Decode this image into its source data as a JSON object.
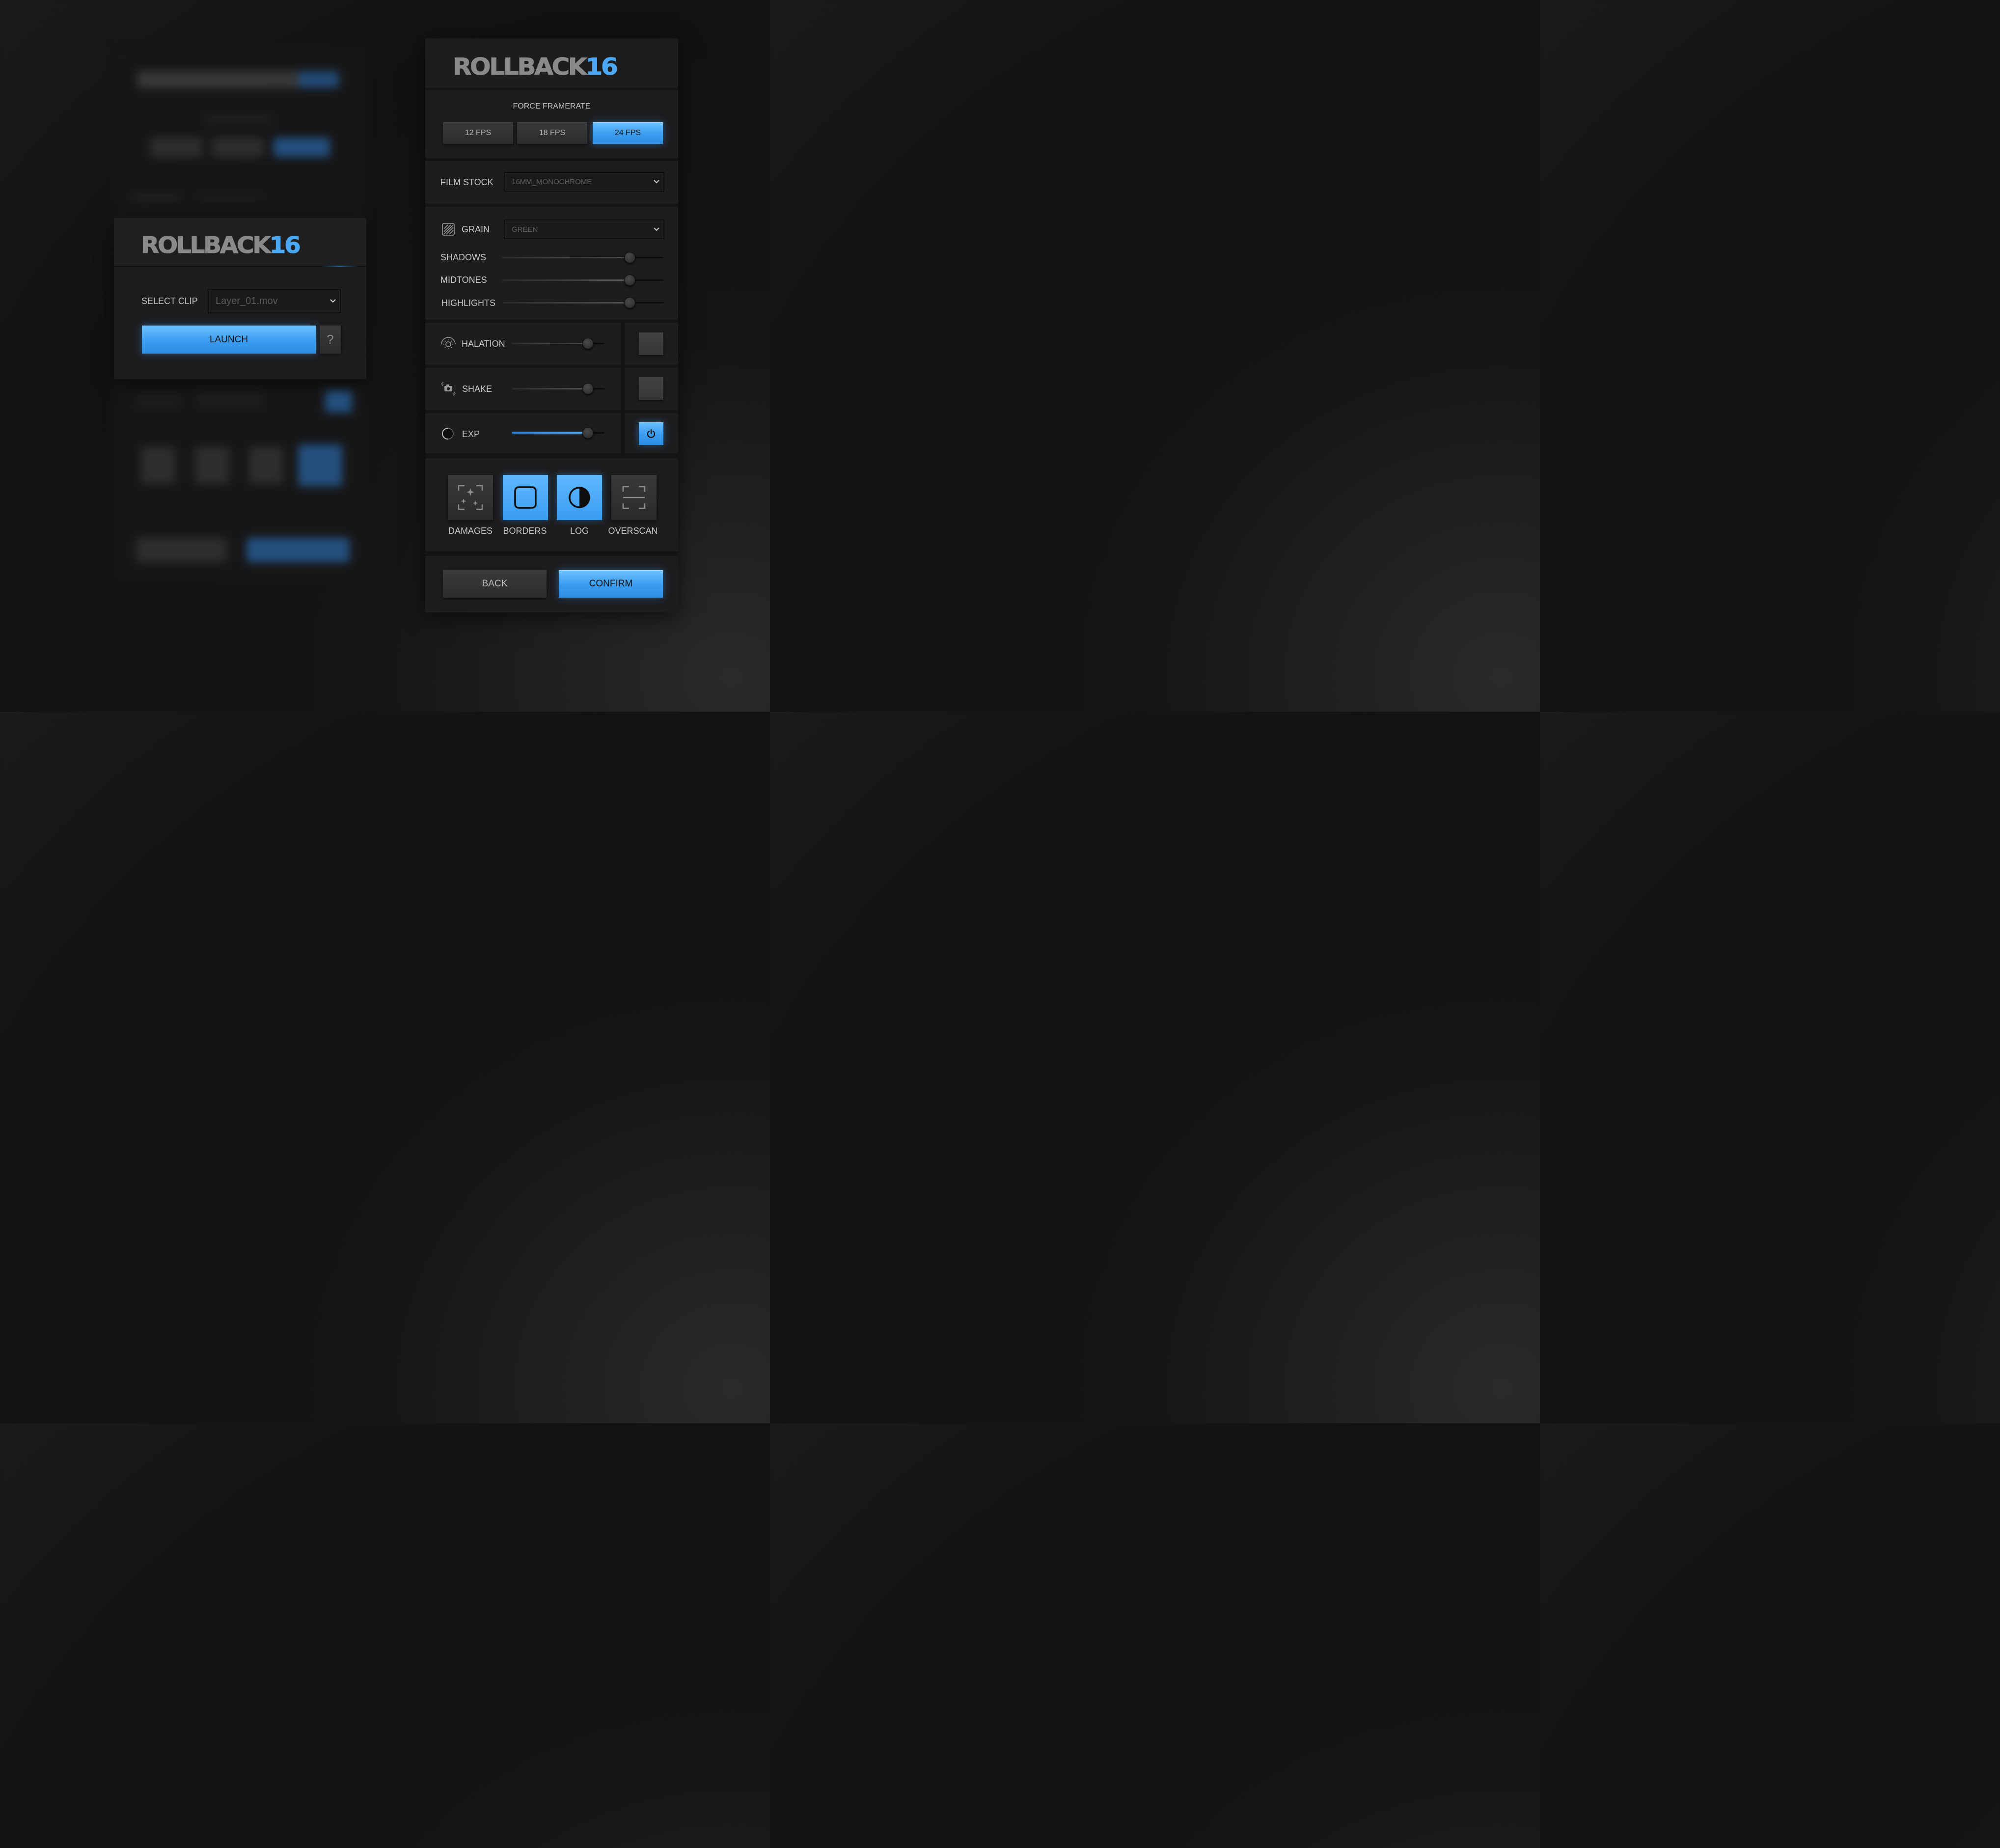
{
  "launcher": {
    "logo_text": "ROLLBACK",
    "logo_number": "16",
    "select_clip_label": "SELECT CLIP",
    "clip_value": "Layer_01.mov",
    "launch_label": "LAUNCH",
    "help_label": "?"
  },
  "settings": {
    "logo_text": "ROLLBACK",
    "logo_number": "16",
    "framerate": {
      "title": "FORCE FRAMERATE",
      "options": [
        "12 FPS",
        "18 FPS",
        "24 FPS"
      ],
      "selected": "24 FPS"
    },
    "film_stock": {
      "label": "FILM STOCK",
      "value": "16MM_MONOCHROME"
    },
    "grain": {
      "label": "GRAIN",
      "value": "GREEN",
      "sliders": [
        {
          "label": "SHADOWS",
          "value": 0.79
        },
        {
          "label": "MIDTONES",
          "value": 0.79
        },
        {
          "label": "HIGHLIGHTS",
          "value": 0.79
        }
      ]
    },
    "effects": [
      {
        "label": "HALATION",
        "value": 0.82,
        "enabled": false,
        "icon": "halation-icon"
      },
      {
        "label": "SHAKE",
        "value": 0.82,
        "enabled": false,
        "icon": "camera-shake-icon"
      },
      {
        "label": "EXP",
        "value": 0.82,
        "enabled": true,
        "icon": "exposure-icon"
      }
    ],
    "toggles": [
      {
        "label": "DAMAGES",
        "active": false,
        "icon": "damages-icon"
      },
      {
        "label": "BORDERS",
        "active": true,
        "icon": "borders-icon"
      },
      {
        "label": "LOG",
        "active": true,
        "icon": "log-icon"
      },
      {
        "label": "OVERSCAN",
        "active": false,
        "icon": "overscan-icon"
      }
    ],
    "back_label": "BACK",
    "confirm_label": "CONFIRM"
  },
  "colors": {
    "accent": "#4aa8f5",
    "panel": "#1d1d1e",
    "background": "#121212"
  }
}
